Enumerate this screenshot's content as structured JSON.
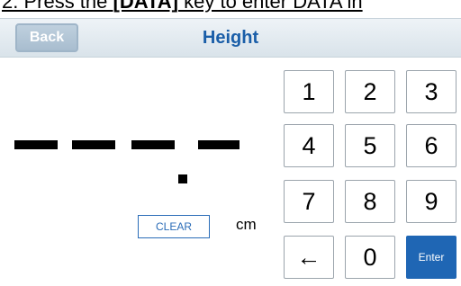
{
  "instruction": {
    "prefix": "2. Press the ",
    "key": "[DATA]",
    "suffix": " key to enter DATA in"
  },
  "header": {
    "back_label": "Back",
    "title": "Height"
  },
  "display": {
    "unit": "cm"
  },
  "clear_label": "CLEAR",
  "keypad": [
    {
      "label": "1"
    },
    {
      "label": "2"
    },
    {
      "label": "3"
    },
    {
      "label": "4"
    },
    {
      "label": "5"
    },
    {
      "label": "6"
    },
    {
      "label": "7"
    },
    {
      "label": "8"
    },
    {
      "label": "9"
    },
    {
      "label": "←"
    },
    {
      "label": "0"
    },
    {
      "label": "Enter"
    }
  ],
  "colors": {
    "title": "#1a5ea8",
    "enter_key": "#1f66b4",
    "back_button": "#a8bdcf"
  }
}
